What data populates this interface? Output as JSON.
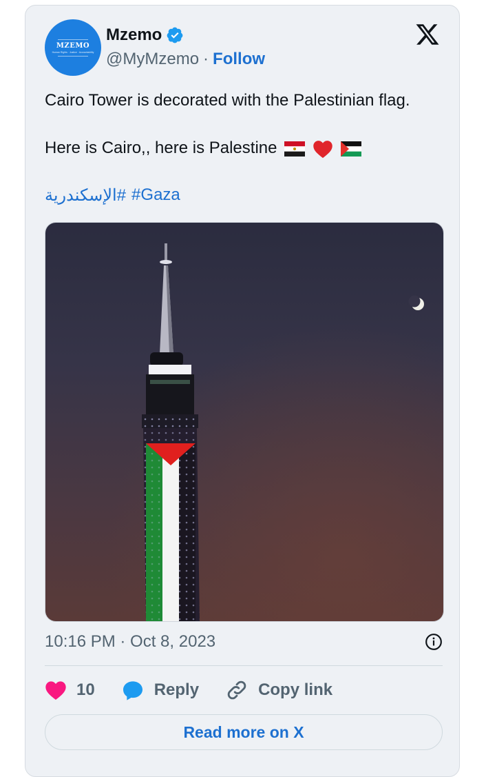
{
  "account": {
    "logo_text": "MZEMO",
    "logo_tagline": "Human Rights · Justice · Accountability",
    "name": "Mzemo",
    "handle": "@MyMzemo",
    "separator": "·",
    "follow_label": "Follow"
  },
  "tweet": {
    "line1": "Cairo Tower is decorated with the Palestinian flag.",
    "line2": "Here is Cairo,, here is Palestine",
    "hashtags": [
      "#الإسكندرية",
      "#Gaza"
    ],
    "timestamp": "10:16 PM · Oct 8, 2023"
  },
  "actions": {
    "like_count": "10",
    "reply_label": "Reply",
    "copy_link_label": "Copy link"
  },
  "read_more_label": "Read more on X",
  "colors": {
    "brand_blue": "#1d70d0",
    "verified": "#1d9bf0",
    "like": "#f91880",
    "reply": "#1d9bf0"
  },
  "icons": [
    "verified-badge-icon",
    "x-logo-icon",
    "info-icon",
    "heart-icon",
    "reply-bubble-icon",
    "link-icon",
    "egypt-flag-icon",
    "red-heart-icon",
    "palestine-flag-icon"
  ]
}
